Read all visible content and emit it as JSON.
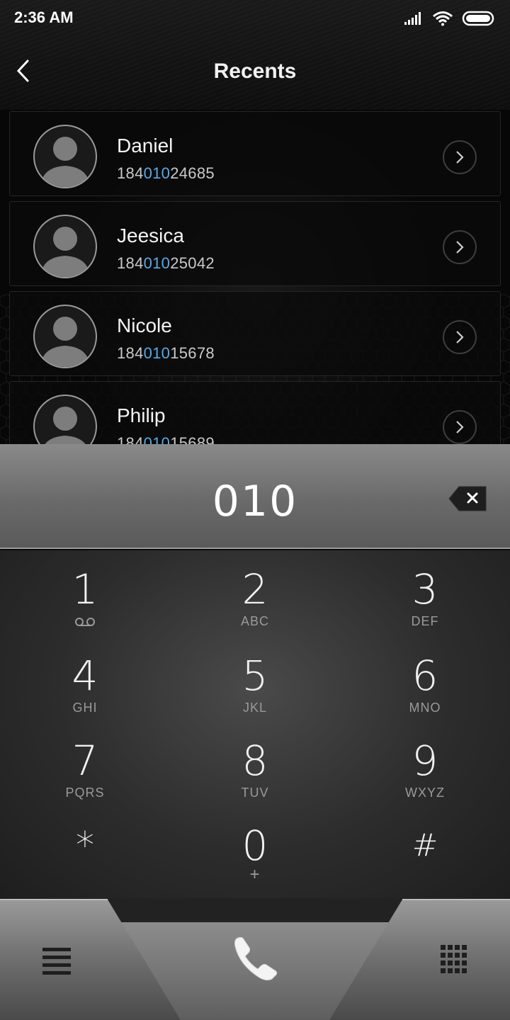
{
  "status": {
    "time": "2:36 AM"
  },
  "header": {
    "title": "Recents"
  },
  "contacts": [
    {
      "name": "Daniel",
      "number_pre": "184",
      "number_hl": "010",
      "number_post": "24685"
    },
    {
      "name": "Jeesica",
      "number_pre": "184",
      "number_hl": "010",
      "number_post": "25042"
    },
    {
      "name": "Nicole",
      "number_pre": "184",
      "number_hl": "010",
      "number_post": "15678"
    },
    {
      "name": "Philip",
      "number_pre": "184",
      "number_hl": "010",
      "number_post": "15689"
    }
  ],
  "dialer": {
    "input": "010"
  },
  "keypad": {
    "keys": [
      {
        "digit": "1",
        "letters": ""
      },
      {
        "digit": "2",
        "letters": "ABC"
      },
      {
        "digit": "3",
        "letters": "DEF"
      },
      {
        "digit": "4",
        "letters": "GHI"
      },
      {
        "digit": "5",
        "letters": "JKL"
      },
      {
        "digit": "6",
        "letters": "MNO"
      },
      {
        "digit": "7",
        "letters": "PQRS"
      },
      {
        "digit": "8",
        "letters": "TUV"
      },
      {
        "digit": "9",
        "letters": "WXYZ"
      },
      {
        "digit": "*",
        "letters": ""
      },
      {
        "digit": "0",
        "letters": "+"
      },
      {
        "digit": "#",
        "letters": ""
      }
    ]
  },
  "colors": {
    "highlight": "#5aa9e6",
    "accent_text": "#f1f1f1"
  },
  "icons": {
    "back": "back-arrow-icon",
    "detail": "chevron-right-icon",
    "backspace": "backspace-icon",
    "call": "phone-icon",
    "menu": "menu-icon",
    "keypad": "keypad-grid-icon"
  }
}
